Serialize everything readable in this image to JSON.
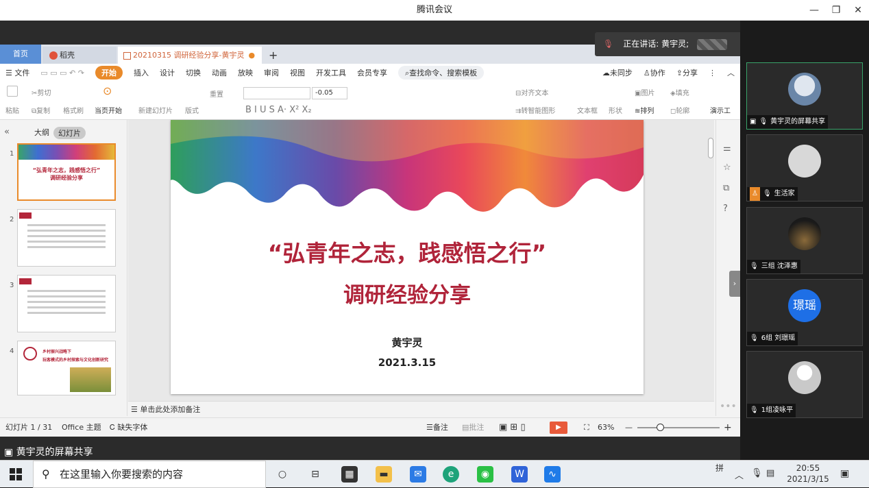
{
  "window": {
    "title": "腾讯会议",
    "min": "—",
    "max": "❐",
    "close": "✕"
  },
  "speaking": {
    "label": "正在讲话: 黄宇灵;"
  },
  "wps": {
    "tabs": {
      "home": "首页",
      "docer": "稻壳",
      "file": "20210315 调研经验分享-黄宇灵",
      "file_dot": "●",
      "new": "+"
    },
    "menu": {
      "file": "☰ 文件",
      "start": "开始",
      "insert": "插入",
      "design": "设计",
      "switch": "切换",
      "anim": "动画",
      "play": "放映",
      "review": "审阅",
      "view": "视图",
      "dev": "开发工具",
      "member": "会员专享",
      "search": "查找命令、搜索模板",
      "unsync": "未同步",
      "collab": "协作",
      "share": "分享"
    },
    "ribbon": {
      "paste": "粘贴",
      "cut": "剪切",
      "copy": "复制",
      "format": "格式刷",
      "fromstart": "当页开始",
      "newslide": "新建幻灯片",
      "layout": "版式",
      "reset": "重置",
      "fontsize": "-0.05",
      "align": "对齐文本",
      "smartart": "转智能图形",
      "textbox": "文本框",
      "shape": "形状",
      "arrange": "排列",
      "picture": "图片",
      "fill": "填充",
      "outline": "轮廓",
      "demo": "演示工"
    },
    "panel": {
      "outline": "大纲",
      "slides": "幻灯片",
      "add": "+"
    },
    "thumbs": [
      {
        "num": "1",
        "title": "“弘青年之志，践感悟之行”",
        "sub": "调研经验分享"
      },
      {
        "num": "2"
      },
      {
        "num": "3"
      },
      {
        "num": "4",
        "title": "乡村振兴战略下",
        "sub": "玩客模式的乡村探索与文化创新研究"
      }
    ],
    "slide": {
      "title": "“弘青年之志，践感悟之行”",
      "subtitle": "调研经验分享",
      "author": "黄宇灵",
      "date": "2021.3.15"
    },
    "notes": "单击此处添加备注",
    "status": {
      "slide": "幻灯片 1 / 31",
      "theme": "Office 主题",
      "font": "缺失字体",
      "notes": "备注",
      "comment": "批注",
      "zoom": "63%",
      "minus": "—",
      "plus": "+"
    }
  },
  "share_label": "黄宇灵的屏幕共享",
  "participants": [
    {
      "name": "黄宇灵的屏幕共享",
      "avatar": "husky"
    },
    {
      "name": "生活家",
      "avatar": "sketch"
    },
    {
      "name": "三组 沈泽惠",
      "avatar": "city"
    },
    {
      "name": "6组 刘璟瑶",
      "avatar": "initial",
      "initial": "璟瑶"
    },
    {
      "name": "1组凌咏平",
      "avatar": "default"
    }
  ],
  "more": "•••",
  "taskbar": {
    "search": "在这里输入你要搜索的内容",
    "ime": "拼",
    "time": "20:55",
    "date": "2021/3/15"
  },
  "colors": {
    "accent": "#e98a2a",
    "title_red": "#b0243a",
    "meeting_bg": "#1b1b1b"
  }
}
